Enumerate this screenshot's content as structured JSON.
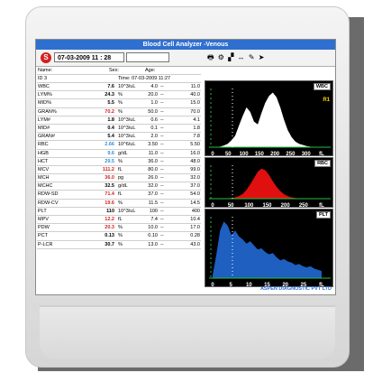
{
  "window": {
    "title": "Blood Cell Analyzer -Venous"
  },
  "toolbar": {
    "datetime": "07-03-2009  11 : 28",
    "icons": [
      "printer-icon",
      "settings-icon",
      "chart-icon",
      "scroll-icon",
      "tools-icon",
      "pointer-icon"
    ]
  },
  "patient": {
    "name_label": "Name:",
    "sex_label": "Sex:",
    "age_label": "Age:",
    "id_label": "ID 3",
    "time": "Time: 07-03-2009 11:27"
  },
  "colors": {
    "normal": "#000000",
    "high": "#d42020",
    "low": "#2f8fe0",
    "wbc": "#ffffff",
    "rbc": "#e01010",
    "plt": "#1e5fc0"
  },
  "rows": [
    {
      "name": "WBC",
      "value": "7.6",
      "unit": "10^3/uL",
      "lo": "4.0",
      "hi": "11.0",
      "flag": "normal"
    },
    {
      "name": "LYM%",
      "value": "24.3",
      "unit": "%",
      "lo": "20.0",
      "hi": "40.0",
      "flag": "normal"
    },
    {
      "name": "MID%",
      "value": "5.5",
      "unit": "%",
      "lo": "1.0",
      "hi": "15.0",
      "flag": "normal"
    },
    {
      "name": "GRAN%",
      "value": "70.2",
      "unit": "%",
      "lo": "50.0",
      "hi": "70.0",
      "flag": "high"
    },
    {
      "name": "LYM#",
      "value": "1.8",
      "unit": "10^3/uL",
      "lo": "0.6",
      "hi": "4.1",
      "flag": "normal"
    },
    {
      "name": "MID#",
      "value": "0.4",
      "unit": "10^3/uL",
      "lo": "0.1",
      "hi": "1.8",
      "flag": "normal"
    },
    {
      "name": "GRAN#",
      "value": "5.4",
      "unit": "10^3/uL",
      "lo": "2.0",
      "hi": "7.8",
      "flag": "normal"
    },
    {
      "name": "RBC",
      "value": "2.66",
      "unit": "10^6/uL",
      "lo": "3.50",
      "hi": "5.50",
      "flag": "low"
    },
    {
      "name": "HGB",
      "value": "9.6",
      "unit": "g/dL",
      "lo": "11.0",
      "hi": "16.0",
      "flag": "low"
    },
    {
      "name": "HCT",
      "value": "29.5",
      "unit": "%",
      "lo": "36.0",
      "hi": "48.0",
      "flag": "low"
    },
    {
      "name": "MCV",
      "value": "111.2",
      "unit": "fL",
      "lo": "80.0",
      "hi": "99.0",
      "flag": "high"
    },
    {
      "name": "MCH",
      "value": "36.0",
      "unit": "pg",
      "lo": "26.0",
      "hi": "32.0",
      "flag": "high"
    },
    {
      "name": "MCHC",
      "value": "32.5",
      "unit": "g/dL",
      "lo": "32.0",
      "hi": "37.0",
      "flag": "normal"
    },
    {
      "name": "RDW-SD",
      "value": "71.4",
      "unit": "fL",
      "lo": "37.0",
      "hi": "54.0",
      "flag": "high"
    },
    {
      "name": "RDW-CV",
      "value": "19.6",
      "unit": "%",
      "lo": "11.5",
      "hi": "14.5",
      "flag": "high"
    },
    {
      "name": "PLT",
      "value": "110",
      "unit": "10^3/uL",
      "lo": "100",
      "hi": "400",
      "flag": "normal"
    },
    {
      "name": "MPV",
      "value": "12.2",
      "unit": "fL",
      "lo": "7.4",
      "hi": "10.4",
      "flag": "high"
    },
    {
      "name": "PDW",
      "value": "20.3",
      "unit": "%",
      "lo": "10.0",
      "hi": "17.0",
      "flag": "high"
    },
    {
      "name": "PCT",
      "value": "0.13",
      "unit": "%",
      "lo": "0.10",
      "hi": "0.28",
      "flag": "normal"
    },
    {
      "name": "P-LCR",
      "value": "30.7",
      "unit": "%",
      "lo": "13.0",
      "hi": "43.0",
      "flag": "normal"
    }
  ],
  "histograms": [
    {
      "label": "WBC",
      "flag": "R1",
      "fill": "#ffffff",
      "ticks": [
        "0",
        "50",
        "100",
        "150",
        "200",
        "250",
        "300",
        "fL"
      ],
      "curve": [
        0,
        0,
        1,
        3,
        6,
        12,
        20,
        38,
        55,
        70,
        62,
        45,
        40,
        60,
        78,
        90,
        96,
        88,
        70,
        48,
        30,
        18,
        10,
        6,
        4,
        2,
        1,
        0,
        0,
        0
      ]
    },
    {
      "label": "RBC",
      "flag": "",
      "fill": "#e01010",
      "ticks": [
        "0",
        "50",
        "100",
        "150",
        "200",
        "250",
        "fL"
      ],
      "curve": [
        0,
        0,
        0,
        0,
        1,
        2,
        4,
        8,
        15,
        28,
        45,
        65,
        85,
        95,
        90,
        75,
        55,
        38,
        24,
        14,
        8,
        4,
        2,
        1,
        0,
        0,
        0,
        0,
        0,
        0
      ]
    },
    {
      "label": "PLT",
      "flag": "",
      "fill": "#1e5fc0",
      "ticks": [
        "0",
        "5",
        "10",
        "15",
        "20",
        "25",
        "fL"
      ],
      "curve": [
        5,
        40,
        80,
        95,
        88,
        72,
        80,
        70,
        65,
        58,
        62,
        55,
        48,
        50,
        44,
        40,
        42,
        35,
        30,
        32,
        28,
        26,
        22,
        24,
        20,
        18,
        20,
        16,
        14,
        12
      ]
    }
  ],
  "footer": "ASPEN DIAGNOSTIC PVT LTD"
}
